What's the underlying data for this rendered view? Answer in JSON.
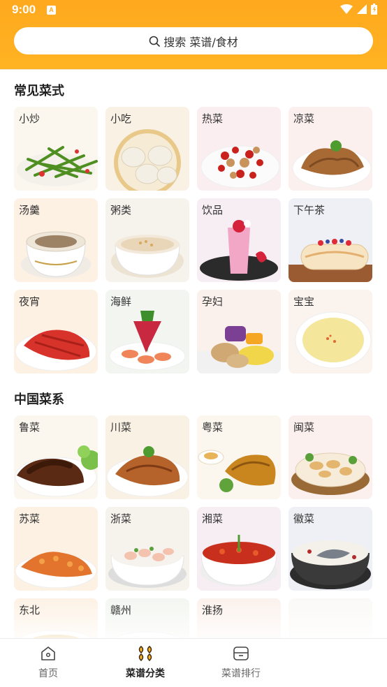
{
  "status_bar": {
    "time": "9:00",
    "notification": "A"
  },
  "search": {
    "placeholder": "搜索 菜谱/食材"
  },
  "sections": [
    {
      "title": "常见菜式",
      "items": [
        {
          "label": "小炒",
          "icon": "stir-fry-image"
        },
        {
          "label": "小吃",
          "icon": "snack-image"
        },
        {
          "label": "热菜",
          "icon": "hot-dish-image"
        },
        {
          "label": "凉菜",
          "icon": "cold-dish-image"
        },
        {
          "label": "汤羹",
          "icon": "soup-image"
        },
        {
          "label": "粥类",
          "icon": "porridge-image"
        },
        {
          "label": "饮品",
          "icon": "drink-image"
        },
        {
          "label": "下午茶",
          "icon": "afternoon-tea-image"
        },
        {
          "label": "夜宵",
          "icon": "late-snack-image"
        },
        {
          "label": "海鲜",
          "icon": "seafood-image"
        },
        {
          "label": "孕妇",
          "icon": "pregnancy-image"
        },
        {
          "label": "宝宝",
          "icon": "baby-food-image"
        }
      ]
    },
    {
      "title": "中国菜系",
      "items": [
        {
          "label": "鲁菜",
          "icon": "shandong-cuisine-image"
        },
        {
          "label": "川菜",
          "icon": "sichuan-cuisine-image"
        },
        {
          "label": "粤菜",
          "icon": "cantonese-cuisine-image"
        },
        {
          "label": "闽菜",
          "icon": "fujian-cuisine-image"
        },
        {
          "label": "苏菜",
          "icon": "jiangsu-cuisine-image"
        },
        {
          "label": "浙菜",
          "icon": "zhejiang-cuisine-image"
        },
        {
          "label": "湘菜",
          "icon": "hunan-cuisine-image"
        },
        {
          "label": "徽菜",
          "icon": "anhui-cuisine-image"
        },
        {
          "label": "东北",
          "icon": "northeast-cuisine-image"
        },
        {
          "label": "赣州",
          "icon": "ganzhou-cuisine-image"
        },
        {
          "label": "淮扬",
          "icon": "huaiyang-cuisine-image"
        },
        {
          "label": "",
          "icon": "blank-image"
        }
      ]
    }
  ],
  "bottom_nav": [
    {
      "label": "首页",
      "icon": "home-icon",
      "active": false
    },
    {
      "label": "菜谱分类",
      "icon": "category-icon",
      "active": true
    },
    {
      "label": "菜谱排行",
      "icon": "ranking-icon",
      "active": false
    }
  ],
  "colors": {
    "accent": "#ffa91e",
    "text": "#333333"
  }
}
